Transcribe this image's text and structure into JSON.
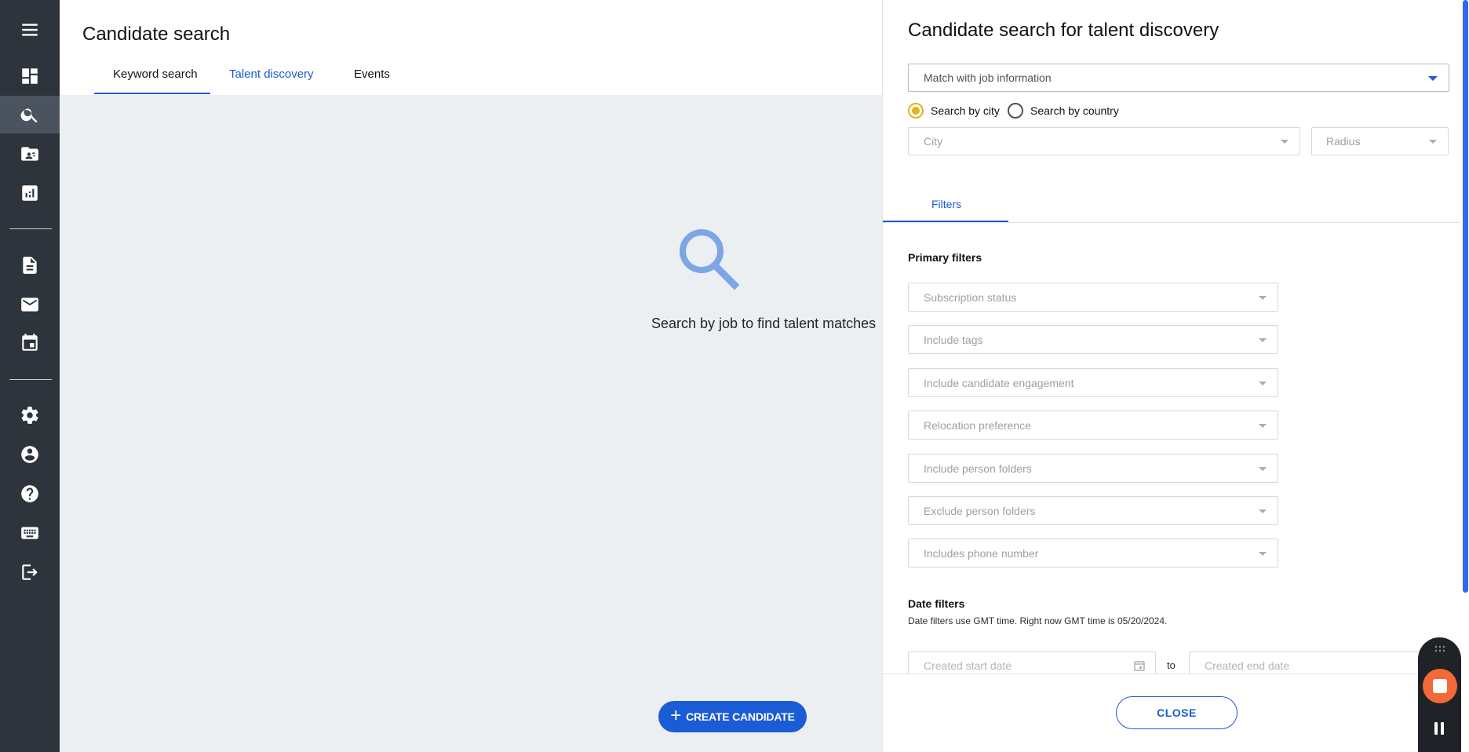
{
  "sidebar": {
    "items": [
      {
        "name": "menu-icon"
      },
      {
        "name": "dashboard-icon"
      },
      {
        "name": "search-icon",
        "active": true
      },
      {
        "name": "contacts-folder-icon"
      },
      {
        "name": "analytics-icon"
      },
      {
        "name": "document-icon"
      },
      {
        "name": "mail-icon"
      },
      {
        "name": "calendar-icon"
      },
      {
        "name": "settings-icon"
      },
      {
        "name": "account-icon"
      },
      {
        "name": "help-icon"
      },
      {
        "name": "keyboard-icon"
      },
      {
        "name": "logout-icon"
      }
    ]
  },
  "header": {
    "title": "Candidate search",
    "tabs": [
      {
        "label": "Keyword search",
        "active": false
      },
      {
        "label": "Talent discovery",
        "active": true
      },
      {
        "label": "Events",
        "active": false
      }
    ]
  },
  "main": {
    "empty_icon": "search-icon",
    "empty_text": "Search by job to find talent matches",
    "create_button": "CREATE CANDIDATE"
  },
  "panel": {
    "title": "Candidate search for talent discovery",
    "job_select": "Match with job information",
    "radios": [
      {
        "label": "Search by city",
        "checked": true
      },
      {
        "label": "Search by country",
        "checked": false
      }
    ],
    "city_placeholder": "City",
    "radius_placeholder": "Radius",
    "filters_tab": "Filters",
    "primary_filters_title": "Primary filters",
    "primary_filters": [
      "Subscription status",
      "Include tags",
      "Include candidate engagement",
      "Relocation preference",
      "Include person folders",
      "Exclude person folders",
      "Includes phone number"
    ],
    "date_filters_title": "Date filters",
    "date_filters_note": "Date filters use GMT time. Right now GMT time is 05/20/2024.",
    "created_start_placeholder": "Created start date",
    "to_label": "to",
    "created_end_placeholder": "Created end date",
    "close_button": "CLOSE"
  },
  "colors": {
    "accent": "#1a5bd6",
    "sidebar": "#2e343b",
    "radio_checked": "#e2b21a",
    "record": "#f26a3a"
  }
}
